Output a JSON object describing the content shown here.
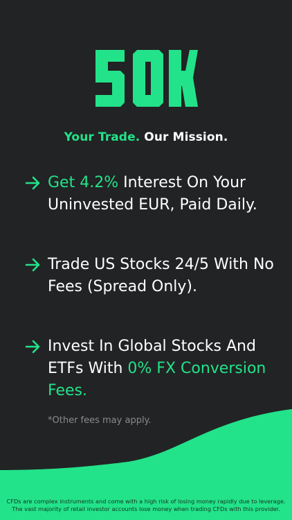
{
  "brand": {
    "logo_text": "50K",
    "accent_color": "#22e38a",
    "background_color": "#222324"
  },
  "tagline": {
    "green_part": "Your Trade.",
    "white_part": "Our Mission."
  },
  "features": [
    {
      "icon": "arrow-right-icon",
      "prefix": "",
      "highlight": "Get 4.2%",
      "suffix": " Interest On Your Uninvested EUR, Paid Daily."
    },
    {
      "icon": "arrow-right-icon",
      "prefix": "Trade US Stocks 24/5 With No Fees (Spread Only).",
      "highlight": "",
      "suffix": ""
    },
    {
      "icon": "arrow-right-icon",
      "prefix": "Invest In Global Stocks And ETFs With ",
      "highlight": "0% FX Conversion Fees.",
      "suffix": ""
    }
  ],
  "fees_note": "*Other fees may apply.",
  "disclaimer": {
    "line1": "CFDs are complex instruments and come with a high risk of losing money rapidly due to leverage.",
    "line2": "The vast majority of retail investor accounts lose money when trading CFDs with this provider."
  }
}
